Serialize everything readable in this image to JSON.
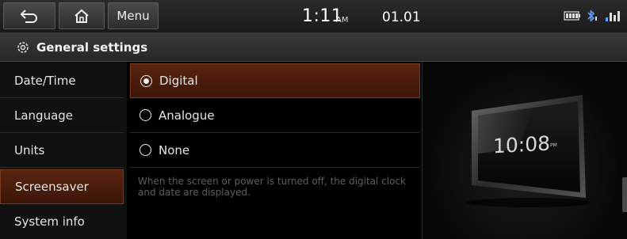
{
  "topbar": {
    "menu_label": "Menu",
    "time": "1:11",
    "ampm": "AM",
    "date": "01.01"
  },
  "title": {
    "text": "General settings"
  },
  "sidebar": {
    "items": [
      {
        "label": "Date/Time"
      },
      {
        "label": "Language"
      },
      {
        "label": "Units"
      },
      {
        "label": "Screensaver"
      },
      {
        "label": "System info"
      }
    ]
  },
  "options": {
    "items": [
      {
        "label": "Digital",
        "selected": true
      },
      {
        "label": "Analogue",
        "selected": false
      },
      {
        "label": "None",
        "selected": false
      }
    ],
    "description": "When the screen or power is turned off, the digital clock and date are displayed."
  },
  "preview": {
    "time": "10:08",
    "ampm": "PM"
  },
  "colors": {
    "accent": "#5a2310",
    "background": "#000000"
  },
  "icons": [
    "back-icon",
    "home-icon",
    "battery-icon",
    "bluetooth-icon",
    "signal-icon",
    "gear-icon",
    "radio-selected-icon",
    "radio-icon"
  ]
}
